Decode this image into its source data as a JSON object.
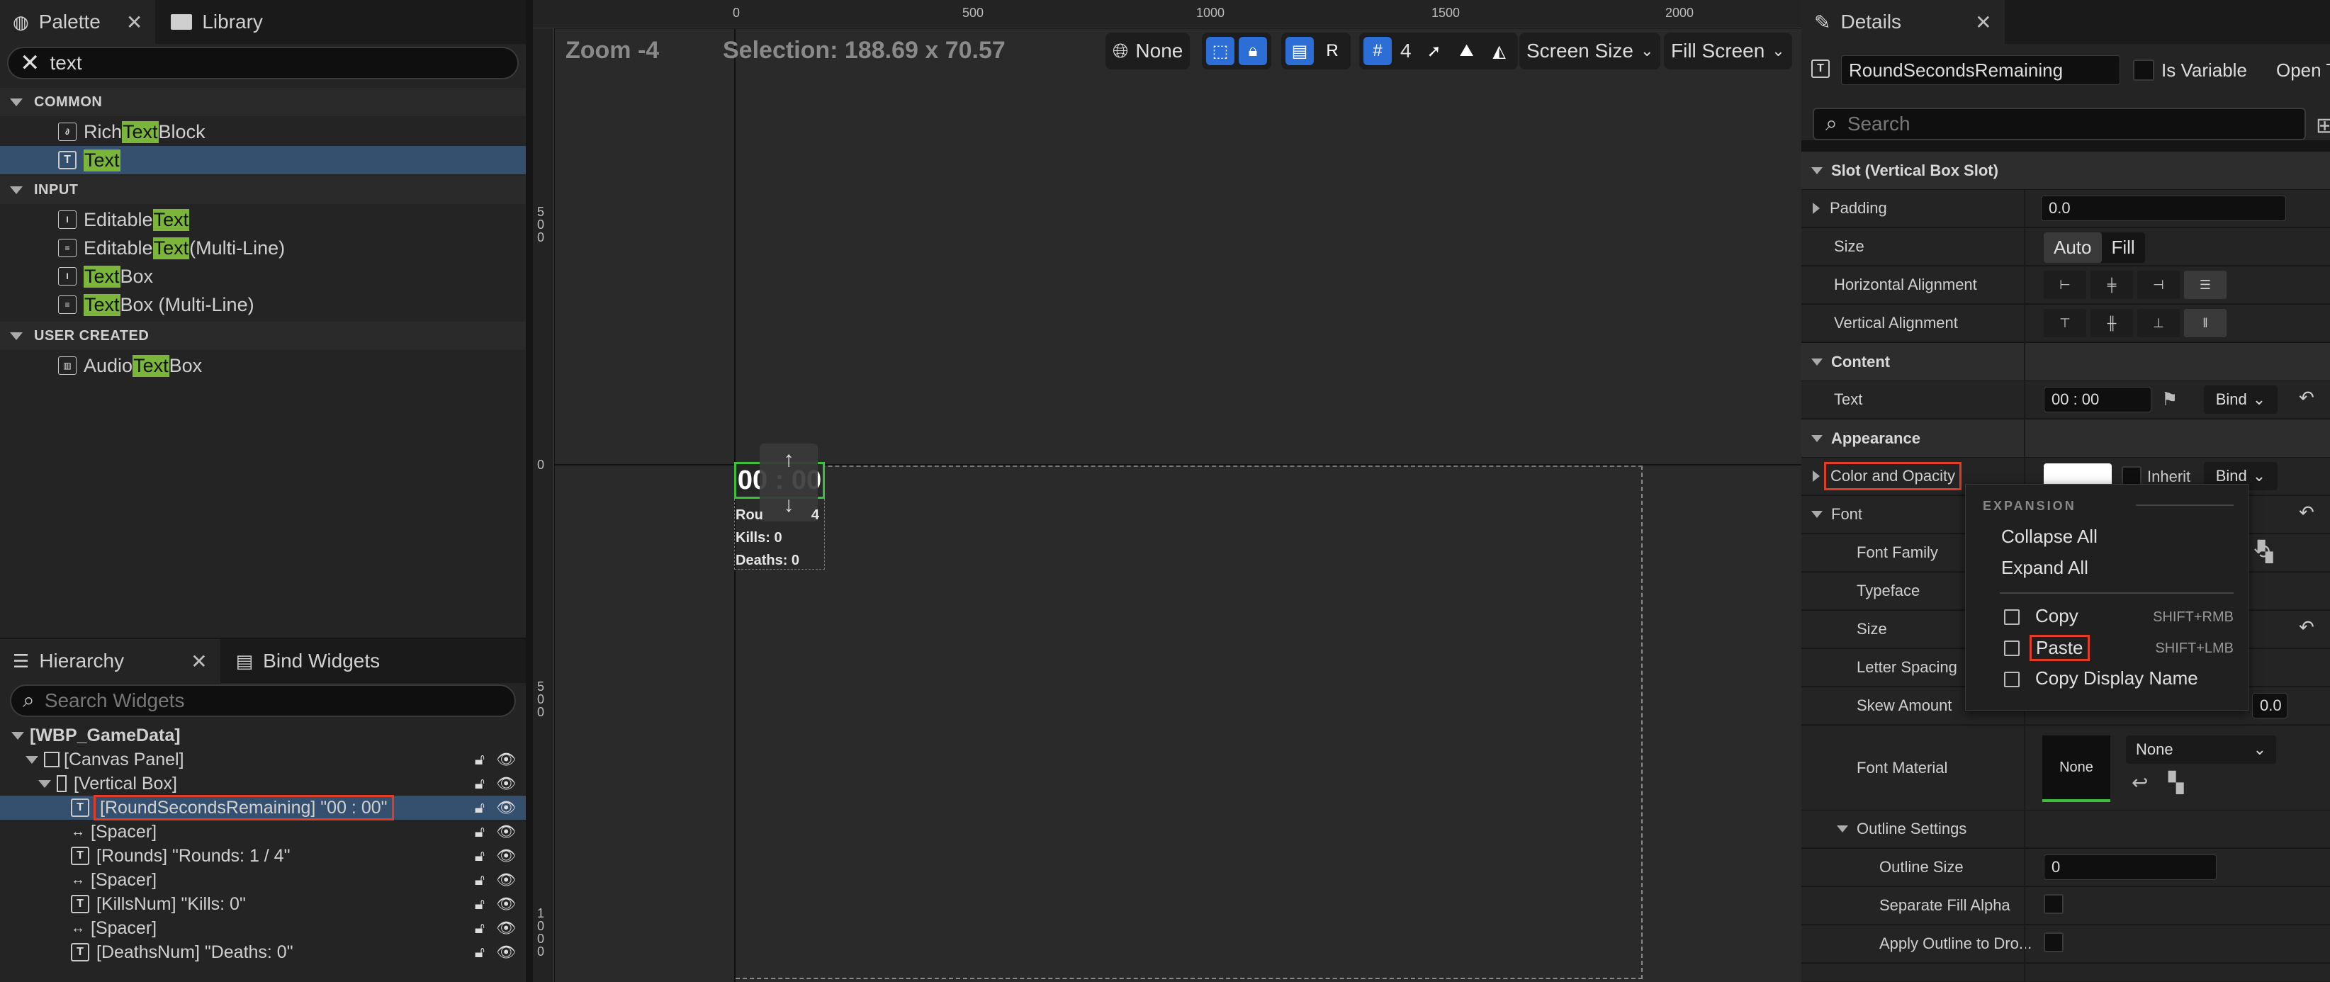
{
  "palette": {
    "tab_label": "Palette",
    "close_glyph": "✕",
    "library_tab": "Library",
    "search_value": "text",
    "categories": {
      "common": "COMMON",
      "input": "INPUT",
      "user_created": "USER CREATED"
    },
    "items": {
      "rich_text_block": {
        "pre": "Rich ",
        "hl": "Text",
        "post": " Block"
      },
      "text": {
        "pre": "",
        "hl": "Text",
        "post": ""
      },
      "editable_text": {
        "pre": "Editable ",
        "hl": "Text",
        "post": ""
      },
      "editable_text_ml": {
        "pre": "Editable ",
        "hl": "Text",
        "post": " (Multi-Line)"
      },
      "text_box": {
        "pre": "",
        "hl": "Text",
        "post": " Box"
      },
      "text_box_ml": {
        "pre": "",
        "hl": "Text",
        "post": " Box (Multi-Line)"
      },
      "audio_text_box": {
        "pre": "Audio ",
        "hl": "Text",
        "post": " Box"
      }
    }
  },
  "hierarchy": {
    "tab_label": "Hierarchy",
    "bind_widgets_tab": "Bind Widgets",
    "search_placeholder": "Search Widgets",
    "rows": {
      "root": "[WBP_GameData]",
      "canvas_panel": "[Canvas Panel]",
      "vertical_box": "[Vertical Box]",
      "round_seconds": "[RoundSecondsRemaining] \"00 : 00\"",
      "spacer1": "[Spacer]",
      "rounds": "[Rounds] \"Rounds: 1 / 4\"",
      "spacer2": "[Spacer]",
      "kills": "[KillsNum] \"Kills: 0\"",
      "spacer3": "[Spacer]",
      "deaths": "[DeathsNum] \"Deaths: 0\""
    }
  },
  "viewport": {
    "zoom": "Zoom -4",
    "selection": "Selection: 188.69 x 70.57",
    "ruler_h": [
      "0",
      "500",
      "1000",
      "1500",
      "2000"
    ],
    "ruler_v": [
      "5\n0\n0",
      "0",
      "5\n0\n0",
      "1\n0\n0\n0"
    ],
    "toolbar": {
      "none_label": "None",
      "r_label": "R",
      "grid_value": "4",
      "screen_size": "Screen Size",
      "fill_screen": "Fill Screen"
    },
    "widget": {
      "timer": "00 : 00",
      "rounds_partial": "Rou",
      "rounds_tail": "4",
      "kills": "Kills: 0",
      "deaths": "Deaths: 0"
    }
  },
  "details": {
    "tab_label": "Details",
    "name_value": "RoundSecondsRemaining",
    "is_variable": "Is Variable",
    "open_partial": "Open T",
    "search_placeholder": "Search",
    "slot_cat": "Slot (Vertical Box Slot)",
    "padding": "Padding",
    "padding_value": "0.0",
    "size": "Size",
    "size_auto": "Auto",
    "size_fill": "Fill",
    "h_align": "Horizontal Alignment",
    "v_align": "Vertical Alignment",
    "content_cat": "Content",
    "text_label": "Text",
    "text_value": "00 : 00",
    "bind": "Bind",
    "appearance_cat": "Appearance",
    "color_opacity": "Color and Opacity",
    "inherit": "Inherit",
    "font": "Font",
    "font_family": "Font Family",
    "typeface": "Typeface",
    "font_size": "Size",
    "letter_spacing": "Letter Spacing",
    "skew_amount": "Skew Amount",
    "skew_value": "0.0",
    "font_material": "Font Material",
    "none_thumb": "None",
    "none_select": "None",
    "outline_settings": "Outline Settings",
    "outline_size": "Outline Size",
    "outline_size_value": "0",
    "separate_fill_alpha": "Separate Fill Alpha",
    "apply_outline": "Apply Outline to Dro..."
  },
  "context_menu": {
    "header": "EXPANSION",
    "collapse_all": "Collapse All",
    "expand_all": "Expand All",
    "copy": "Copy",
    "copy_shortcut": "SHIFT+RMB",
    "paste": "Paste",
    "paste_shortcut": "SHIFT+LMB",
    "copy_display_name": "Copy Display Name"
  },
  "colors": {
    "accent_blue": "#2c6ed6",
    "selection": "#35506e",
    "highlight_green": "#7bb53a",
    "annotation_red": "#e03c26",
    "widget_green": "#3dbf3d"
  }
}
